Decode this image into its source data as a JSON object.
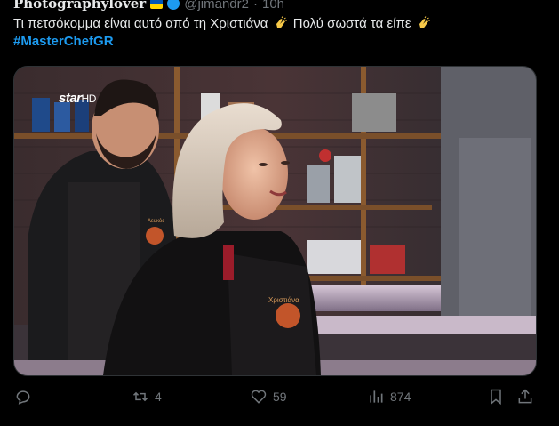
{
  "tweet": {
    "author_name": "Photographylover",
    "handle": "@jimandr2",
    "separator": "·",
    "time": "10h",
    "text_line1": "Τι πετσόκομμα είναι αυτό από τη Χριστιάνα",
    "text_line1b": "Πολύ σωστά τα είπε",
    "hashtag": "#MasterChefGR"
  },
  "media": {
    "watermark_brand": "star",
    "watermark_hd": "HD",
    "apron_label_left": "Λευκός",
    "apron_label_right": "Χριστιάνα"
  },
  "actions": {
    "reply_icon": "reply-icon",
    "retweets": "4",
    "likes": "59",
    "views": "874",
    "bookmark_icon": "bookmark-icon",
    "share_icon": "share-icon"
  },
  "colors": {
    "link": "#1d9bf0",
    "muted": "#71767b",
    "text": "#e7e9ea"
  }
}
